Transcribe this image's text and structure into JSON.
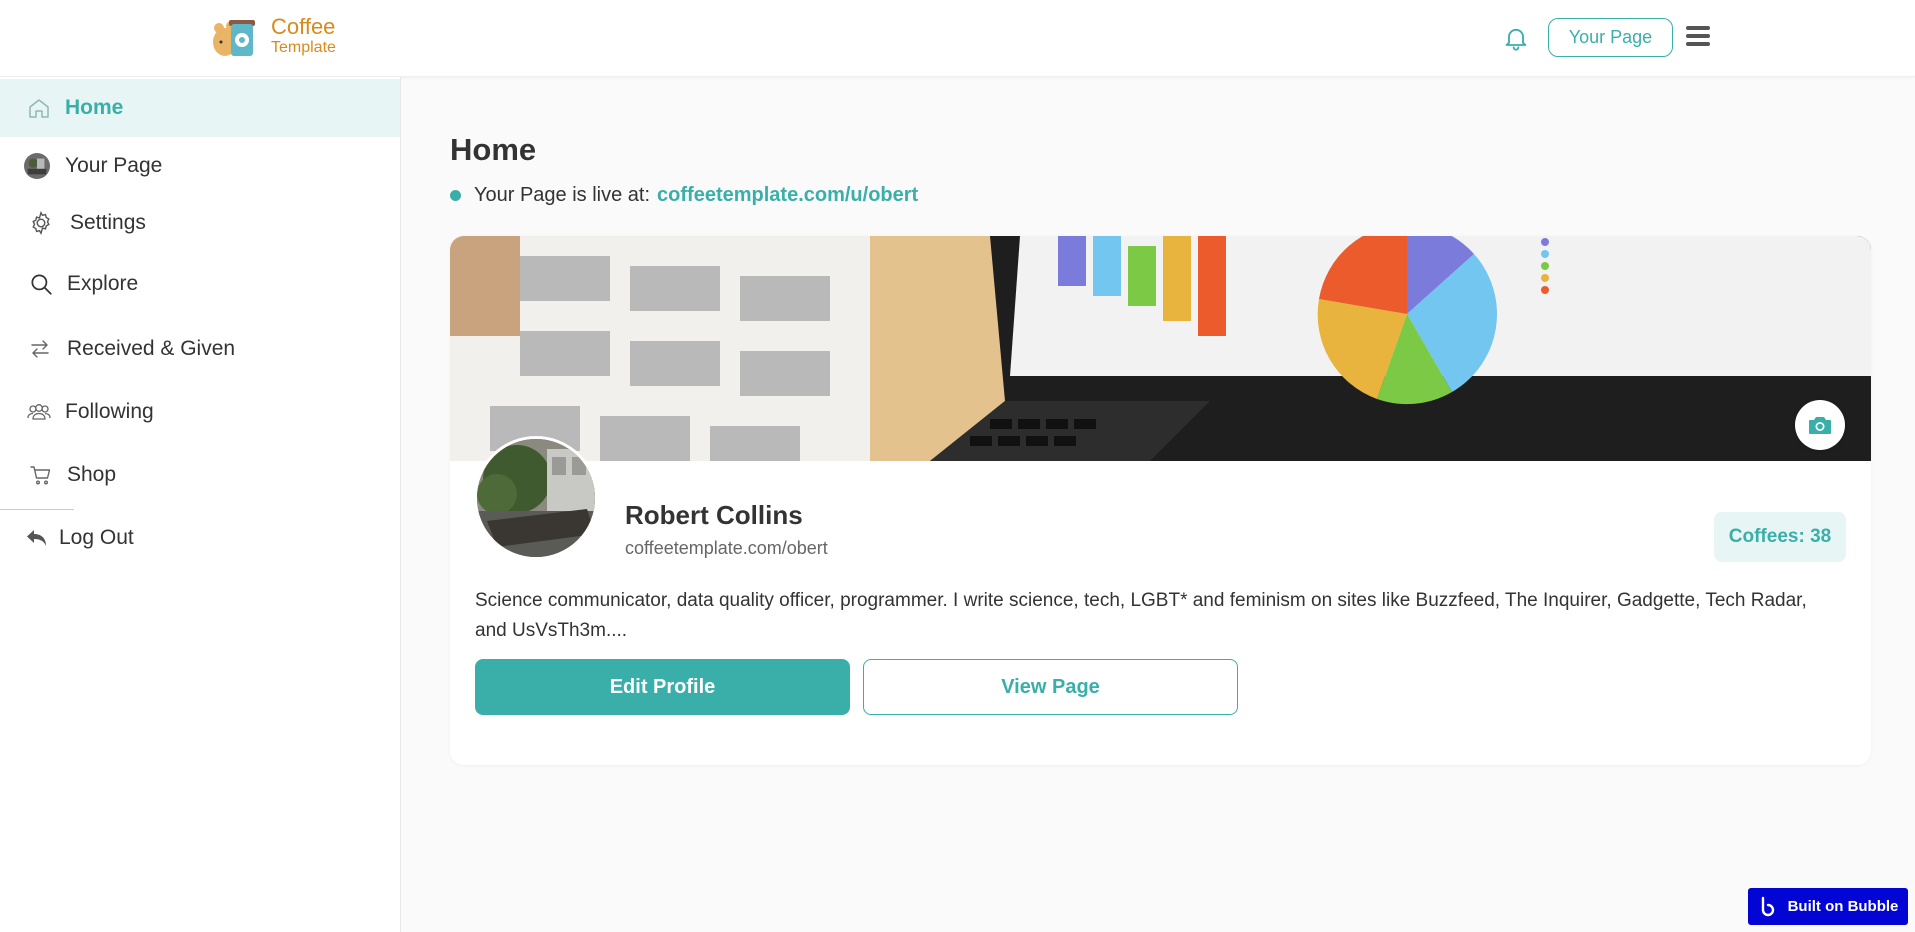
{
  "brand": {
    "name_line1": "Coffee",
    "name_line2": "Template",
    "color": "#d98a1c"
  },
  "topbar": {
    "notification_icon": "bell-icon",
    "your_page_label": "Your Page",
    "menu_icon": "hamburger-icon"
  },
  "sidebar": {
    "items": [
      {
        "label": "Home",
        "icon": "home-icon",
        "active": true
      },
      {
        "label": "Your Page",
        "icon": "avatar-icon",
        "active": false
      },
      {
        "label": "Settings",
        "icon": "gear-icon",
        "active": false
      },
      {
        "label": "Explore",
        "icon": "search-icon",
        "active": false
      },
      {
        "label": "Received & Given",
        "icon": "swap-arrows-icon",
        "active": false
      },
      {
        "label": "Following",
        "icon": "people-icon",
        "active": false
      },
      {
        "label": "Shop",
        "icon": "cart-icon",
        "active": false
      },
      {
        "label": "Log Out",
        "icon": "reply-arrow-icon",
        "active": false
      }
    ]
  },
  "main": {
    "title": "Home",
    "live_prefix": "Your Page is live at:",
    "live_url": "coffeetemplate.com/u/obert"
  },
  "profile": {
    "name": "Robert Collins",
    "handle": "coffeetemplate.com/obert",
    "coffees_label": "Coffees: 38",
    "bio": "Science communicator, data quality officer, programmer. I write science, tech, LGBT* and feminism on sites like Buzzfeed, The Inquirer, Gadgette, Tech Radar, and UsVsTh3m....",
    "edit_button": "Edit Profile",
    "view_button": "View Page",
    "cover_camera_icon": "camera-icon"
  },
  "badge": {
    "label": "Built on Bubble"
  },
  "colors": {
    "accent": "#3aafa9",
    "accent_light": "#e8f5f5",
    "bubble_blue": "#0205d3"
  }
}
